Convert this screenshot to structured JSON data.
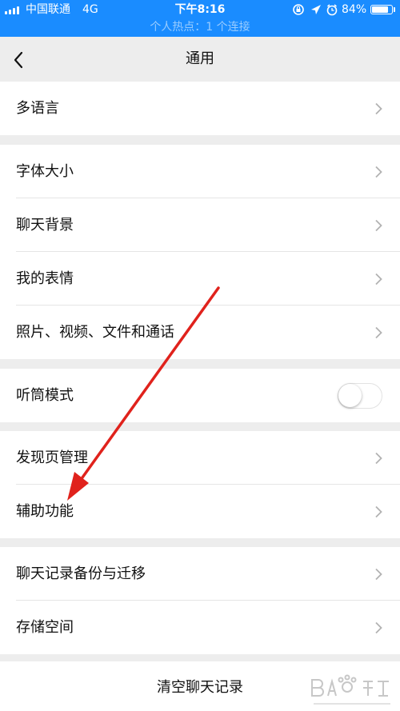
{
  "status_bar": {
    "carrier": "中国联通",
    "network": "4G",
    "time": "下午8:16",
    "battery_percent": "84%",
    "battery_level": 0.84,
    "hotspot": "个人热点：1 个连接",
    "icons": [
      "lock-rotation-icon",
      "location-icon",
      "alarm-icon"
    ]
  },
  "nav": {
    "back_icon": "chevron-left-icon",
    "title": "通用"
  },
  "groups": [
    {
      "items": [
        "多语言"
      ]
    },
    {
      "items": [
        "字体大小",
        "聊天背景",
        "我的表情",
        "照片、视频、文件和通话"
      ]
    },
    {
      "items": [
        "听筒模式"
      ],
      "toggle_on": false
    },
    {
      "items": [
        "发现页管理",
        "辅助功能"
      ]
    },
    {
      "items": [
        "聊天记录备份与迁移",
        "存储空间"
      ]
    }
  ],
  "clear_chat_label": "清空聊天记录",
  "colors": {
    "status_bar": "#1a8cff",
    "background": "#ededed",
    "annotation_arrow": "#e0221c"
  }
}
